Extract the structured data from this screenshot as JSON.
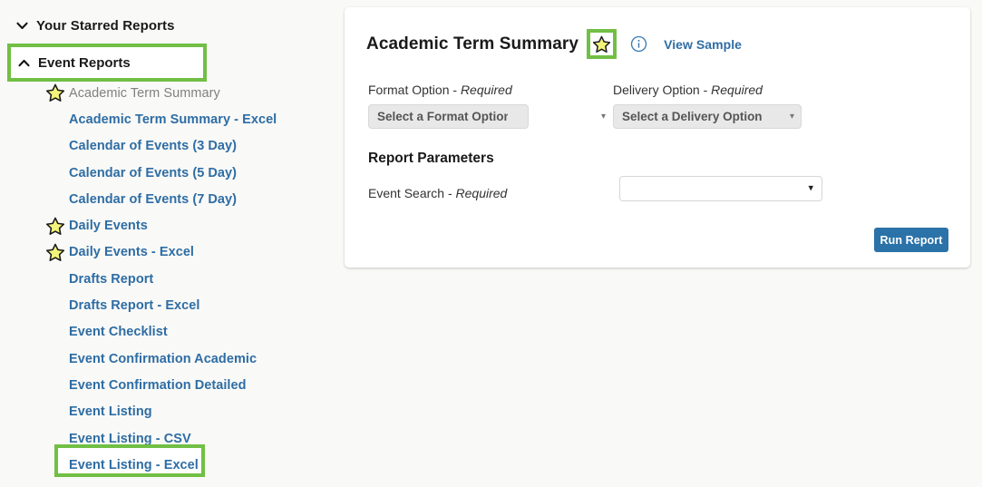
{
  "sidebar": {
    "groups": [
      {
        "label": "Your Starred Reports",
        "icon": "chevron-down-icon",
        "expanded": false
      },
      {
        "label": "Event Reports",
        "icon": "chevron-up-icon",
        "expanded": true,
        "highlighted": true
      }
    ],
    "reports": [
      {
        "label": "Academic Term Summary",
        "starred": true,
        "state": "current"
      },
      {
        "label": "Academic Term Summary - Excel",
        "starred": false,
        "state": "link"
      },
      {
        "label": "Calendar of Events (3 Day)",
        "starred": false,
        "state": "link"
      },
      {
        "label": "Calendar of Events (5 Day)",
        "starred": false,
        "state": "link"
      },
      {
        "label": "Calendar of Events (7 Day)",
        "starred": false,
        "state": "link"
      },
      {
        "label": "Daily Events",
        "starred": true,
        "state": "link"
      },
      {
        "label": "Daily Events - Excel",
        "starred": true,
        "state": "link"
      },
      {
        "label": "Drafts Report",
        "starred": false,
        "state": "link"
      },
      {
        "label": "Drafts Report - Excel",
        "starred": false,
        "state": "link"
      },
      {
        "label": "Event Checklist",
        "starred": false,
        "state": "link"
      },
      {
        "label": "Event Confirmation Academic",
        "starred": false,
        "state": "link"
      },
      {
        "label": "Event Confirmation Detailed",
        "starred": false,
        "state": "link"
      },
      {
        "label": "Event Listing",
        "starred": false,
        "state": "link"
      },
      {
        "label": "Event Listing - CSV",
        "starred": false,
        "state": "link"
      },
      {
        "label": "Event Listing - Excel",
        "starred": false,
        "state": "link",
        "highlighted": true
      }
    ]
  },
  "card": {
    "title": "Academic Term Summary",
    "star_icon": "star-icon",
    "info_icon": "info-icon",
    "view_sample_label": "View Sample",
    "format": {
      "label_main": "Format Option",
      "label_suffix": "Required",
      "separator": "-",
      "selected": "Select a Format Option",
      "caret_icon": "chevron-down-icon"
    },
    "delivery": {
      "label_main": "Delivery Option",
      "label_suffix": "Required",
      "separator": "-",
      "selected": "Select a Delivery Option",
      "caret_icon": "chevron-down-icon"
    },
    "report_parameters_title": "Report Parameters",
    "event_search": {
      "label_main": "Event Search",
      "label_suffix": "Required",
      "separator": "-",
      "selected": "",
      "caret_icon": "chevron-down-icon"
    },
    "run_report_label": "Run Report"
  },
  "colors": {
    "highlight_green": "#71bf44",
    "link_blue": "#2e6da4",
    "button_blue": "#2b72a8",
    "star_yellow": "#f4f47a",
    "page_bg": "#f9f9f7",
    "card_bg": "#ffffff",
    "current_gray": "#808080"
  }
}
